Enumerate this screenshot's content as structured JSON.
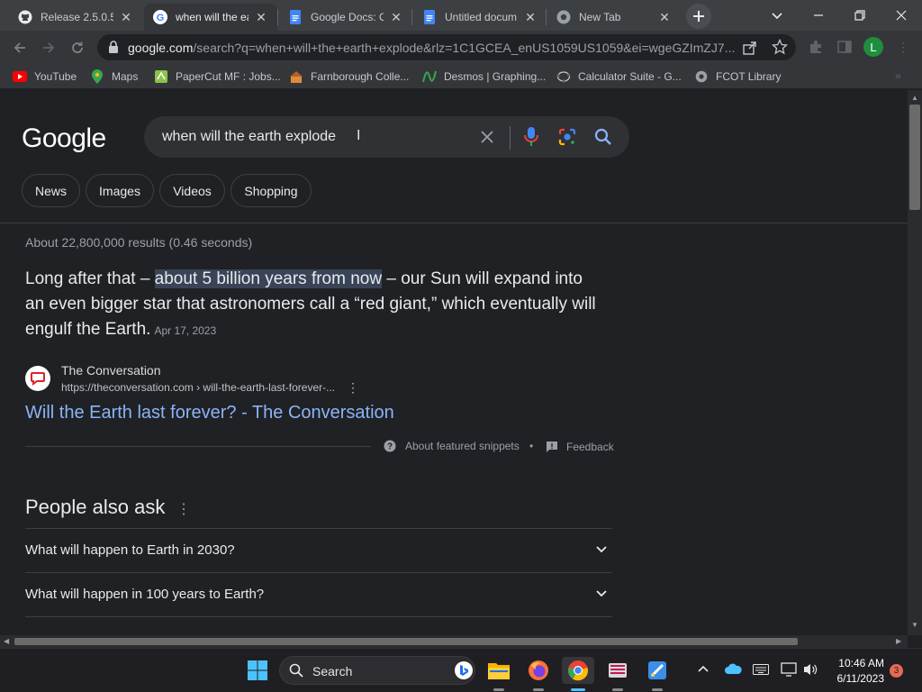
{
  "tabs": [
    {
      "label": "Release 2.5.0.5",
      "icon": "github-icon",
      "active": false
    },
    {
      "label": "when will the ea",
      "icon": "google-g-icon",
      "active": true
    },
    {
      "label": "Google Docs: O",
      "icon": "google-docs-icon",
      "active": false
    },
    {
      "label": "Untitled docum",
      "icon": "google-docs-icon",
      "active": false
    },
    {
      "label": "New Tab",
      "icon": "chrome-icon",
      "active": false
    }
  ],
  "window_controls": [
    "tab-search",
    "minimize",
    "restore",
    "close"
  ],
  "toolbar": {
    "url_host": "google.com",
    "url_rest": "/search?q=when+will+the+earth+explode&rlz=1C1GCEA_enUS1059US1059&ei=wgeGZImZJ7...",
    "profile_initial": "L"
  },
  "bookmarks": [
    {
      "label": "YouTube",
      "icon": "youtube-icon"
    },
    {
      "label": "Maps",
      "icon": "maps-icon"
    },
    {
      "label": "PaperCut MF : Jobs...",
      "icon": "papercut-icon"
    },
    {
      "label": "Farnborough Colle...",
      "icon": "farnborough-icon"
    },
    {
      "label": "Desmos | Graphing...",
      "icon": "desmos-icon"
    },
    {
      "label": "Calculator Suite - G...",
      "icon": "geogebra-icon"
    },
    {
      "label": "FCOT Library",
      "icon": "globe-icon"
    }
  ],
  "search": {
    "logo": "Google",
    "query": "when will the earth explode",
    "chips": [
      "News",
      "Images",
      "Videos",
      "Shopping"
    ],
    "stats": "About 22,800,000 results (0.46 seconds)"
  },
  "snippet": {
    "before": "Long after that – ",
    "highlight": "about 5 billion years from now",
    "after": " – our Sun will expand into an even bigger star that astronomers call a “red giant,” which eventually will engulf the Earth.",
    "date": "Apr 17, 2023",
    "source_name": "The Conversation",
    "source_url": "https://theconversation.com › will-the-earth-last-forever-...",
    "title": "Will the Earth last forever? - The Conversation",
    "about_label": "About featured snippets",
    "feedback_label": "Feedback"
  },
  "people_also_ask": {
    "heading": "People also ask",
    "questions": [
      "What will happen to Earth in 2030?",
      "What will happen in 100 years to Earth?"
    ]
  },
  "taskbar": {
    "search_label": "Search",
    "time": "10:46 AM",
    "date": "6/11/2023",
    "notifications": "3"
  },
  "colors": {
    "page_bg": "#202124",
    "link": "#8ab4f8",
    "highlight": "#394457",
    "tabstrip": "#3c4043",
    "toolbar": "#35363a"
  }
}
